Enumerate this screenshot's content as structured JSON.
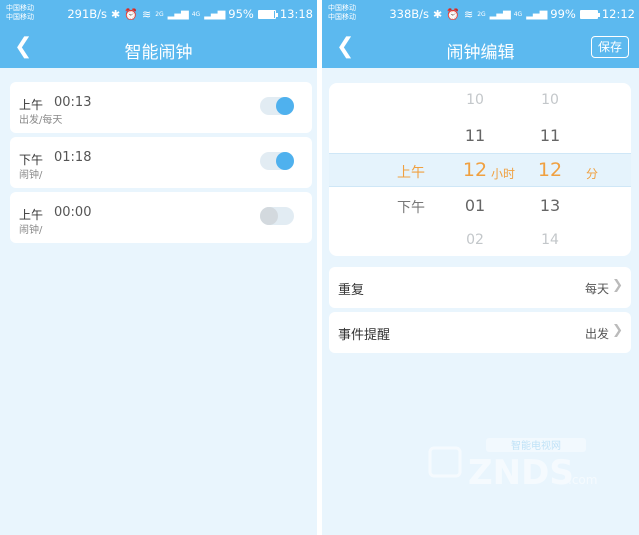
{
  "left_screen": {
    "status": {
      "carrier_1": "中国移动",
      "carrier_2": "中国移动",
      "speed": "291B/s",
      "net_tag": "2G",
      "net_tag_2": "4G",
      "battery_pct_text": "95%",
      "battery_level": 0.95,
      "time": "13:18"
    },
    "title": "智能闹钟",
    "alarms": [
      {
        "ampm": "上午",
        "time": "00:13",
        "label": "出发/每天",
        "enabled": true
      },
      {
        "ampm": "下午",
        "time": "01:18",
        "label": "闹钟/",
        "enabled": true
      },
      {
        "ampm": "上午",
        "time": "00:00",
        "label": "闹钟/",
        "enabled": false
      }
    ]
  },
  "right_screen": {
    "status": {
      "carrier_1": "中国移动",
      "carrier_2": "中国移动",
      "speed": "338B/s",
      "net_tag": "2G",
      "net_tag_2": "4G",
      "battery_pct_text": "99%",
      "battery_level": 0.99,
      "time": "12:12"
    },
    "title": "闹钟编辑",
    "save_label": "保存",
    "picker": {
      "ampm_selected": "上午",
      "ampm_next": "下午",
      "hours": {
        "prev2": "10",
        "prev1": "11",
        "selected": "12",
        "next1": "01",
        "next2": "02"
      },
      "hour_unit": "小时",
      "minutes": {
        "prev2": "10",
        "prev1": "11",
        "selected": "12",
        "next1": "13",
        "next2": "14"
      },
      "minute_unit": "分"
    },
    "settings": [
      {
        "label": "重复",
        "value": "每天"
      },
      {
        "label": "事件提醒",
        "value": "出发"
      }
    ]
  },
  "watermark": {
    "text": "ZNDS",
    "suffix": ".com",
    "tagline": "智能电视网"
  },
  "colors": {
    "header_blue": "#5cb9ef",
    "page_bg": "#e9f5fd",
    "toggle_on": "#4fb1ee",
    "picker_selected": "#f0a040"
  },
  "icons": {
    "back": "chevron-left-icon",
    "bluetooth": "bluetooth-icon",
    "alarm": "alarm-clock-icon",
    "wifi": "wifi-icon",
    "signal": "signal-icon",
    "battery": "battery-icon",
    "row_arrow": "chevron-right-icon"
  }
}
